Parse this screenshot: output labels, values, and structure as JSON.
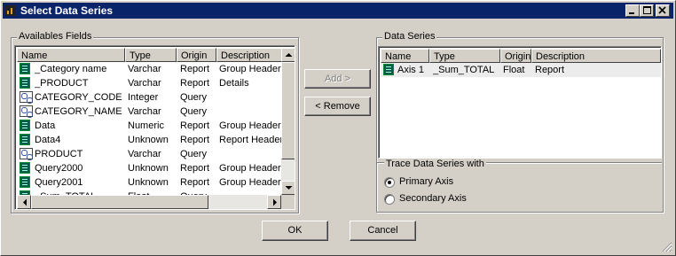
{
  "window": {
    "title": "Select Data Series"
  },
  "available_fields": {
    "group_label": "Availables Fields",
    "columns": [
      "Name",
      "Type",
      "Origin",
      "Description"
    ],
    "rows": [
      {
        "icon": "report",
        "name": "_Category name",
        "type": "Varchar",
        "origin": "Report",
        "description": "Group Header"
      },
      {
        "icon": "report",
        "name": "_PRODUCT",
        "type": "Varchar",
        "origin": "Report",
        "description": "Details"
      },
      {
        "icon": "query",
        "name": "CATEGORY_CODE",
        "type": "Integer",
        "origin": "Query",
        "description": ""
      },
      {
        "icon": "query",
        "name": "CATEGORY_NAME",
        "type": "Varchar",
        "origin": "Query",
        "description": ""
      },
      {
        "icon": "report",
        "name": "Data",
        "type": "Numeric",
        "origin": "Report",
        "description": "Group Header"
      },
      {
        "icon": "report",
        "name": "Data4",
        "type": "Unknown",
        "origin": "Report",
        "description": "Report Header"
      },
      {
        "icon": "query",
        "name": "PRODUCT",
        "type": "Varchar",
        "origin": "Query",
        "description": ""
      },
      {
        "icon": "report",
        "name": "Query2000",
        "type": "Unknown",
        "origin": "Report",
        "description": "Group Header"
      },
      {
        "icon": "report",
        "name": "Query2001",
        "type": "Unknown",
        "origin": "Report",
        "description": "Group Header"
      },
      {
        "icon": "report",
        "name": "_Sum_TOTAL",
        "type": "Float",
        "origin": "Query",
        "description": ""
      }
    ]
  },
  "buttons": {
    "add": "Add >",
    "remove": "< Remove",
    "ok": "OK",
    "cancel": "Cancel"
  },
  "data_series": {
    "group_label": "Data Series",
    "columns": [
      "Name",
      "Type",
      "Origin",
      "Description"
    ],
    "rows": [
      {
        "icon": "report",
        "name": "Axis 1",
        "type": "_Sum_TOTAL",
        "origin": "Float",
        "description": "Report"
      }
    ]
  },
  "trace": {
    "group_label": "Trace Data Series with",
    "primary": "Primary Axis",
    "secondary": "Secondary Axis",
    "selected": "primary"
  }
}
